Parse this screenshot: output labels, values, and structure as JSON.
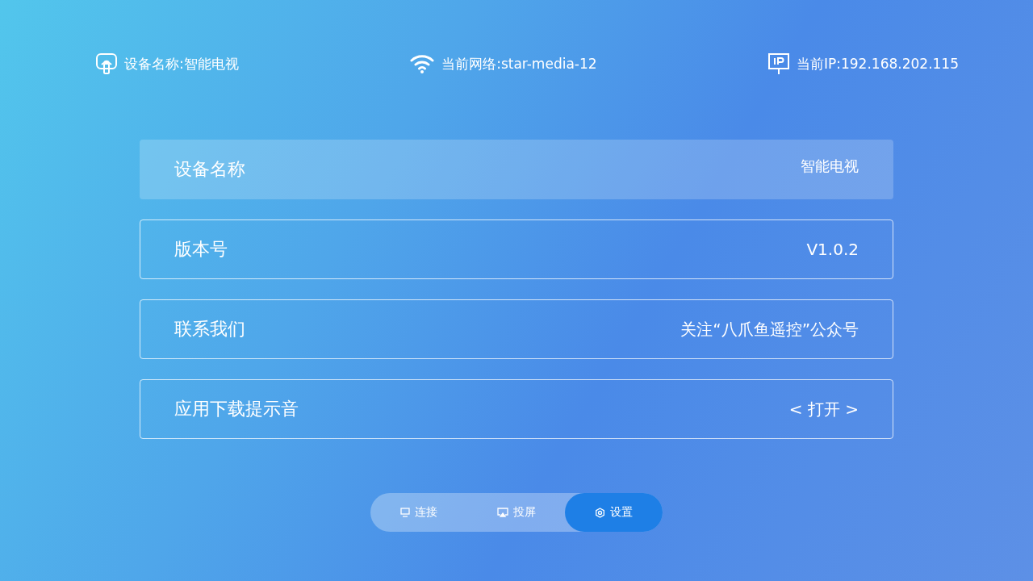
{
  "status_bar": [
    {
      "kind": "device",
      "text": "设备名称:智能电视"
    },
    {
      "kind": "wifi",
      "text": "当前网络:star-media-12"
    },
    {
      "kind": "ip",
      "text": "当前IP:192.168.202.115"
    }
  ],
  "settings": [
    {
      "label": "设备名称",
      "value": "智能电视",
      "selected": true
    },
    {
      "label": "版本号",
      "value": "V1.0.2",
      "selected": false
    },
    {
      "label": "联系我们",
      "value": "关注“八爪鱼遥控”公众号",
      "selected": false
    },
    {
      "label": "应用下载提示音",
      "value": "< 打开 >",
      "selected": false
    }
  ],
  "tabs": [
    {
      "kind": "monitor",
      "label": "连接",
      "selected": false
    },
    {
      "kind": "cast",
      "label": "投屏",
      "selected": false
    },
    {
      "kind": "gear",
      "label": "设置",
      "selected": true
    }
  ]
}
